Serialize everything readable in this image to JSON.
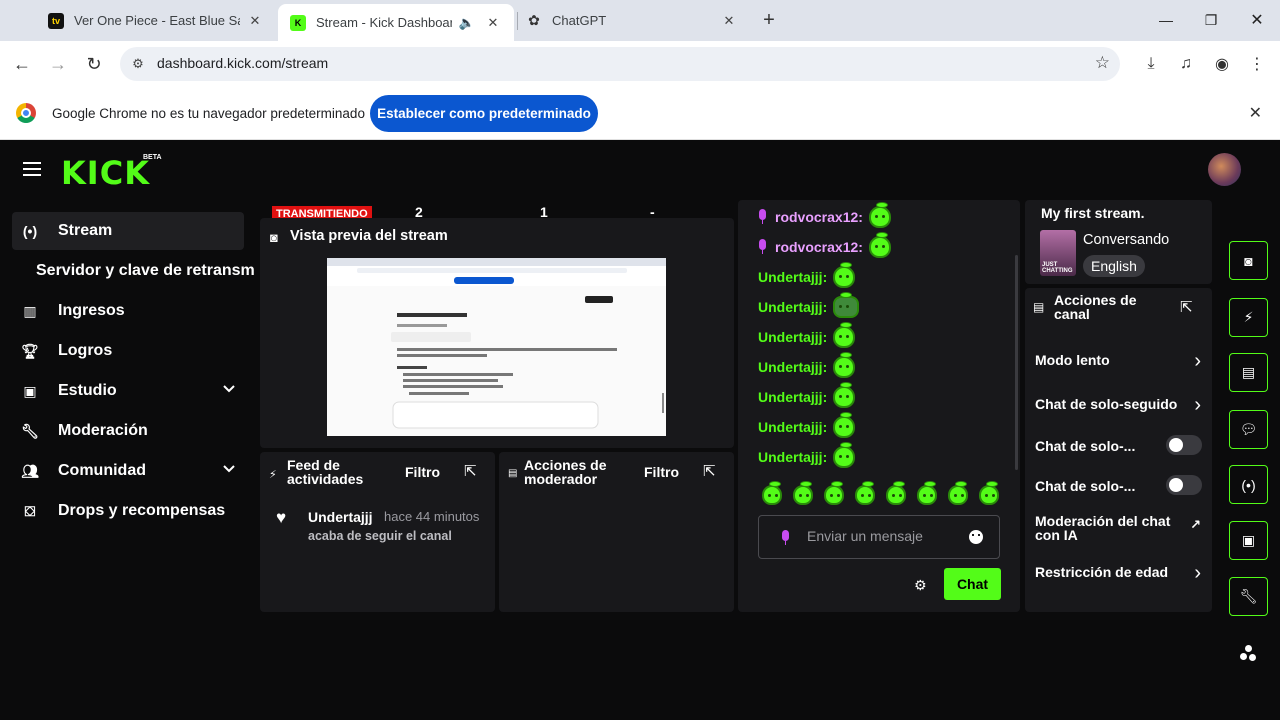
{
  "browser": {
    "tabs": [
      {
        "title": "Ver One Piece - East Blue Saga",
        "favicon": "tv-icon",
        "active": false
      },
      {
        "title": "Stream - Kick Dashboard",
        "favicon": "kick-icon",
        "active": true
      },
      {
        "title": "ChatGPT",
        "favicon": "chatgpt-icon",
        "active": false
      }
    ],
    "url": "dashboard.kick.com/stream",
    "infobar_text": "Google Chrome no es tu navegador predeterminado",
    "infobar_button": "Establecer como predeterminado"
  },
  "kick": {
    "logo": "KICK",
    "beta": "BETA",
    "sidebar": {
      "stream": "Stream",
      "stream_sub": "Servidor y clave de retransm",
      "ingresos": "Ingresos",
      "logros": "Logros",
      "estudio": "Estudio",
      "moderacion": "Moderación",
      "comunidad": "Comunidad",
      "drops": "Drops y recompensas"
    },
    "status": {
      "live": "TRANSMITIENDO",
      "stat1": "2",
      "stat2": "1",
      "stat3": "-"
    },
    "preview": {
      "title": "Vista previa del stream"
    },
    "activity": {
      "title_line1": "Feed de",
      "title_line2": "actividades",
      "filter": "Filtro",
      "item_user": "Undertajjj",
      "item_time": "hace 44 minutos",
      "item_text": "acaba de seguir el canal"
    },
    "mod_actions": {
      "title_line1": "Acciones de",
      "title_line2": "moderador",
      "filter": "Filtro"
    },
    "chat": {
      "messages": [
        {
          "user": "rodvocrax12:",
          "color": "pink"
        },
        {
          "user": "rodvocrax12:",
          "color": "pink"
        },
        {
          "user": "Undertajjj:",
          "color": "green"
        },
        {
          "user": "Undertajjj:",
          "color": "green"
        },
        {
          "user": "Undertajjj:",
          "color": "green"
        },
        {
          "user": "Undertajjj:",
          "color": "green"
        },
        {
          "user": "Undertajjj:",
          "color": "green"
        },
        {
          "user": "Undertajjj:",
          "color": "green"
        },
        {
          "user": "Undertajjj:",
          "color": "green"
        }
      ],
      "input_placeholder": "Enviar un mensaje",
      "send_label": "Chat"
    },
    "info": {
      "title": "My first stream.",
      "category": "Conversando",
      "language": "English",
      "thumb_text_1": "JUST",
      "thumb_text_2": "CHATTING"
    },
    "channel_actions": {
      "title_line1": "Acciones de",
      "title_line2": "canal",
      "slow_mode": "Modo lento",
      "followers_only": "Chat de solo-seguido",
      "chat_only_1": "Chat de solo-...",
      "chat_only_2": "Chat de solo-...",
      "ai_mod_line1": "Moderación del chat",
      "ai_mod_line2": "con IA",
      "age_restriction": "Restricción de edad"
    },
    "accent_color": "#53fc18",
    "live_color": "#e01111"
  }
}
